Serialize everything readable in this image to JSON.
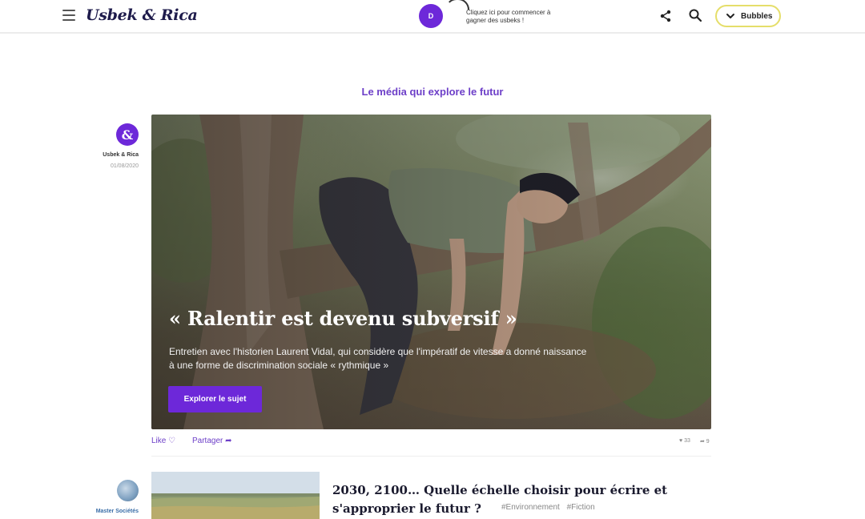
{
  "header": {
    "logo": "Usbek & Rica",
    "user_initial": "D",
    "hint": "Cliquez ici pour commencer à gagner des usbeks !",
    "bubbles_label": "Bubbles"
  },
  "tagline": "Le média qui explore le futur",
  "hero_article": {
    "author_badge": "&",
    "author": "Usbek & Rica",
    "date": "01/08/2020",
    "title": "« Ralentir est devenu subversif »",
    "description": "Entretien avec l'historien Laurent Vidal, qui considère que l'impératif de vitesse a donné naissance à une forme de discrimination sociale « rythmique »",
    "cta": "Explorer le sujet",
    "like_label": "Like ♡",
    "share_label": "Partager ➦",
    "likes_count": "♥ 33",
    "shares_count": "➦ 9"
  },
  "second_article": {
    "author": "Master Sociétés",
    "title": "2030, 2100… Quelle échelle choisir pour écrire et s'approprier le futur ?",
    "tags": [
      "#Environnement",
      "#Fiction"
    ]
  }
}
